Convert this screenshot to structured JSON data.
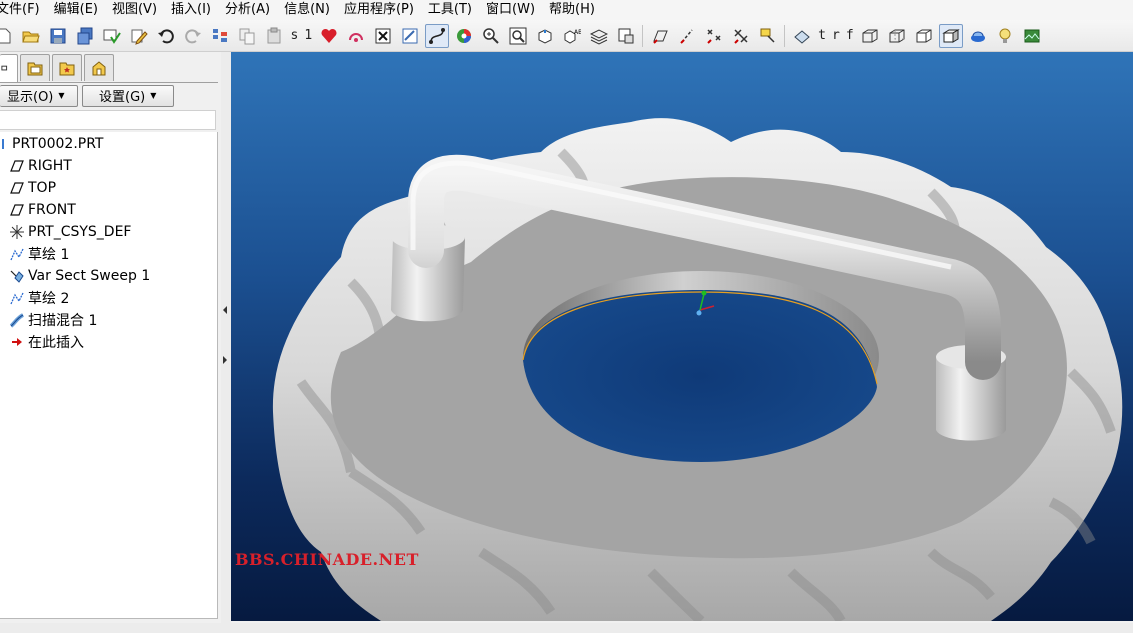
{
  "menu": [
    "文件(F)",
    "编辑(E)",
    "视图(V)",
    "插入(I)",
    "分析(A)",
    "信息(N)",
    "应用程序(P)",
    "工具(T)",
    "窗口(W)",
    "帮助(H)"
  ],
  "toolbar": {
    "text_s": "s",
    "text_1": "1",
    "text_t": "t",
    "text_r": "r",
    "text_f": "f"
  },
  "left_panel": {
    "show_label": "显示(O)",
    "settings_label": "设置(G)"
  },
  "model_tree": {
    "root": "PRT0002.PRT",
    "items": [
      {
        "label": "RIGHT",
        "icon": "datum-plane-icon"
      },
      {
        "label": "TOP",
        "icon": "datum-plane-icon"
      },
      {
        "label": "FRONT",
        "icon": "datum-plane-icon"
      },
      {
        "label": "PRT_CSYS_DEF",
        "icon": "coordinate-system-icon"
      },
      {
        "label": "草绘 1",
        "icon": "sketch-icon"
      },
      {
        "label": "Var Sect Sweep 1",
        "icon": "variable-sweep-icon"
      },
      {
        "label": "草绘 2",
        "icon": "sketch-icon"
      },
      {
        "label": "扫描混合 1",
        "icon": "swept-blend-icon"
      },
      {
        "label": "在此插入",
        "icon": "insert-here-arrow-icon"
      }
    ]
  },
  "watermark": "BBS.CHINADE.NET",
  "colors": {
    "viewport_top": "#2f74b8",
    "viewport_bottom": "#061a40",
    "model_surface": "#a4a4a4",
    "watermark": "#d8202a",
    "csys_x": "#d02030",
    "csys_y": "#20c020",
    "csys_z": "#2090e0",
    "edge_highlight": "#e8a020"
  }
}
